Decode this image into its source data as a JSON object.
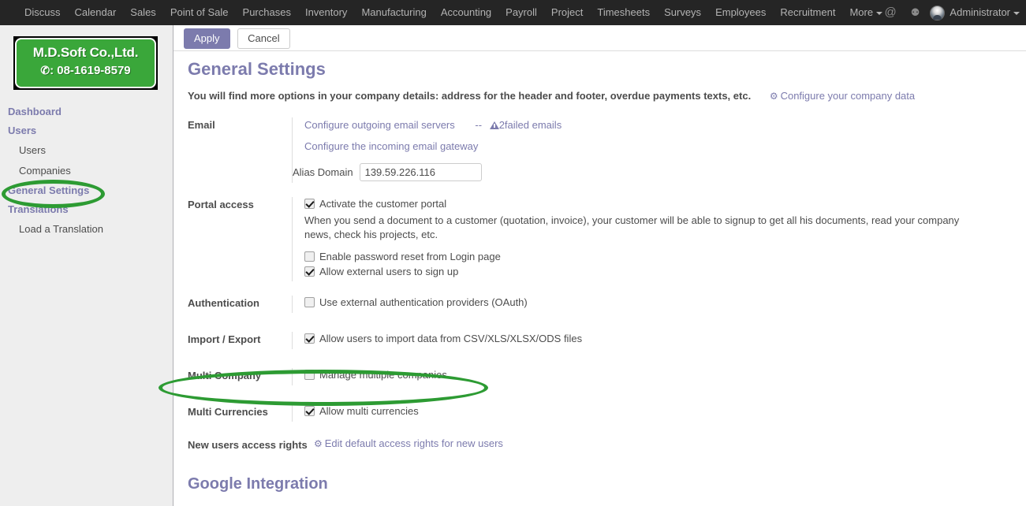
{
  "topbar": {
    "menu": [
      {
        "label": "Discuss"
      },
      {
        "label": "Calendar"
      },
      {
        "label": "Sales"
      },
      {
        "label": "Point of Sale"
      },
      {
        "label": "Purchases"
      },
      {
        "label": "Inventory"
      },
      {
        "label": "Manufacturing"
      },
      {
        "label": "Accounting"
      },
      {
        "label": "Payroll"
      },
      {
        "label": "Project"
      },
      {
        "label": "Timesheets"
      },
      {
        "label": "Surveys"
      },
      {
        "label": "Employees"
      },
      {
        "label": "Recruitment"
      },
      {
        "label": "More"
      }
    ],
    "mail_icon": "@",
    "chat_icon": "⚉",
    "username": "Administrator"
  },
  "actionbar": {
    "apply_label": "Apply",
    "cancel_label": "Cancel"
  },
  "sidebar": {
    "logo": {
      "company": "M.D.Soft Co.,Ltd.",
      "phone_glyph": "✆",
      "phone": ": 08-1619-8579",
      "bg_color": "#3aa73a"
    },
    "items": [
      {
        "label": "Dashboard",
        "type": "head"
      },
      {
        "label": "Users",
        "type": "head"
      },
      {
        "label": "Users",
        "type": "sub"
      },
      {
        "label": "Companies",
        "type": "sub"
      },
      {
        "label": "General Settings",
        "type": "head"
      },
      {
        "label": "Translations",
        "type": "head"
      },
      {
        "label": "Load a Translation",
        "type": "sub"
      }
    ]
  },
  "main": {
    "title": "General Settings",
    "subtitle": "You will find more options in your company details: address for the header and footer, overdue payments texts, etc.",
    "company_data_link": "Configure your company data",
    "sections": {
      "email": {
        "label": "Email",
        "outgoing_link": "Configure outgoing email servers",
        "separator": "--",
        "failed_emails": "2failed emails",
        "incoming_link": "Configure the incoming email gateway",
        "alias_domain_label": "Alias Domain",
        "alias_domain_value": "139.59.226.116"
      },
      "portal": {
        "label": "Portal access",
        "activate_label": "Activate the customer portal",
        "activate_checked": true,
        "description": "When you send a document to a customer (quotation, invoice), your customer will be able to signup to get all his documents, read your company news, check his projects, etc.",
        "password_reset_label": "Enable password reset from Login page",
        "password_reset_checked": false,
        "external_signup_label": "Allow external users to sign up",
        "external_signup_checked": true
      },
      "authentication": {
        "label": "Authentication",
        "oauth_label": "Use external authentication providers (OAuth)",
        "oauth_checked": false
      },
      "import_export": {
        "label": "Import / Export",
        "import_label": "Allow users to import data from CSV/XLS/XLSX/ODS files",
        "import_checked": true
      },
      "multi_company": {
        "label": "Multi Company",
        "manage_label": "Manage multiple companies",
        "manage_checked": false
      },
      "multi_currencies": {
        "label": "Multi Currencies",
        "allow_label": "Allow multi currencies",
        "allow_checked": true
      },
      "new_users": {
        "label": "New users access rights",
        "edit_link": "Edit default access rights for new users"
      }
    },
    "google_section_title": "Google Integration"
  },
  "annotations": {
    "color": "#2d9b33",
    "items": [
      {
        "target": "General Settings sidebar item"
      },
      {
        "target": "Multi Company row"
      }
    ]
  }
}
